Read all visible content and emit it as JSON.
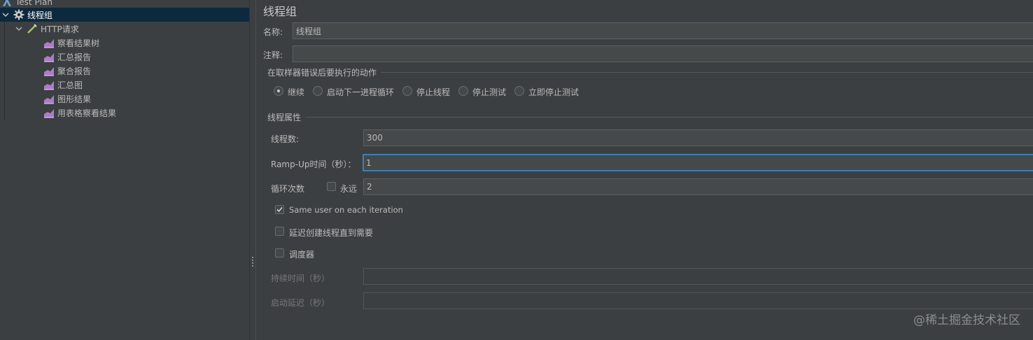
{
  "tree": {
    "root": "Test Plan",
    "thread_group": "线程组",
    "sampler": "HTTP请求",
    "listeners": [
      "察看结果树",
      "汇总报告",
      "聚合报告",
      "汇总图",
      "图形结果",
      "用表格察看结果"
    ]
  },
  "editor": {
    "title": "线程组",
    "name_label": "名称:",
    "name_value": "线程组",
    "comment_label": "注释:",
    "comment_value": "",
    "on_error": {
      "legend": "在取样器错误后要执行的动作",
      "options": [
        "继续",
        "启动下一进程循环",
        "停止线程",
        "停止测试",
        "立即停止测试"
      ],
      "selected": "继续"
    },
    "thread_props": {
      "legend": "线程属性",
      "threads_label": "线程数:",
      "threads_value": "300",
      "rampup_label": "Ramp-Up时间（秒）：",
      "rampup_value": "1",
      "loop_label": "循环次数",
      "forever_label": "永远",
      "forever_checked": false,
      "loop_value": "2",
      "same_user_label": "Same user on each iteration",
      "same_user_checked": true,
      "delay_label": "延迟创建线程直到需要",
      "delay_checked": false,
      "scheduler_label": "调度器",
      "scheduler_checked": false,
      "duration_label": "持续时间（秒）",
      "duration_value": "",
      "startup_delay_label": "启动延迟（秒）",
      "startup_delay_value": ""
    }
  },
  "watermark": "@稀土掘金技术社区",
  "colors": {
    "selection": "#0d293e",
    "focus_border": "#3d7fb5",
    "background": "#3c3f41"
  }
}
